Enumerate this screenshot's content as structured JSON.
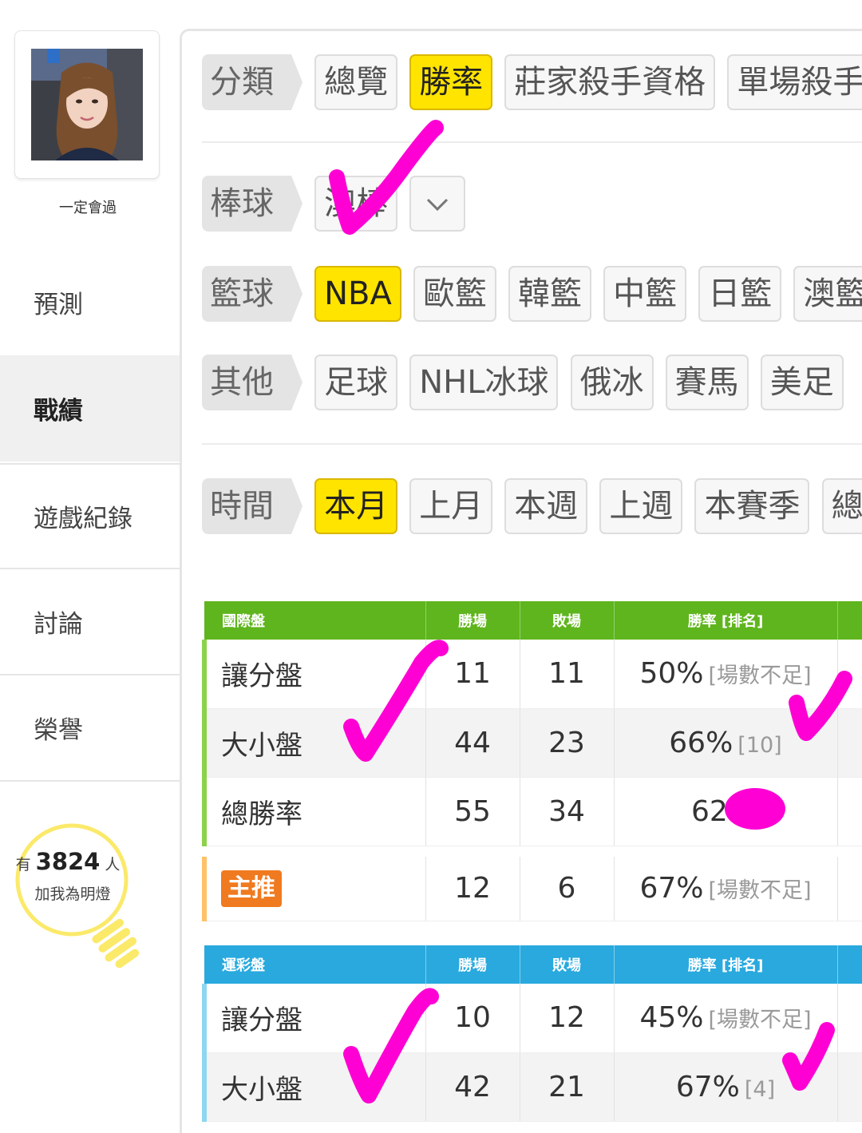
{
  "sidebar": {
    "username": "一定會過",
    "items": [
      {
        "label": "預測"
      },
      {
        "label": "戰績"
      },
      {
        "label": "遊戲紀錄"
      },
      {
        "label": "討論"
      },
      {
        "label": "榮譽"
      }
    ],
    "fans": {
      "prefix": "有",
      "count": "3824",
      "suffix": "人",
      "caption": "加我為明燈"
    }
  },
  "filters": {
    "category": {
      "label": "分類",
      "options": [
        "總覽",
        "勝率",
        "莊家殺手資格",
        "單場殺手"
      ],
      "selected": "勝率"
    },
    "baseball": {
      "label": "棒球",
      "options": [
        "澳棒"
      ],
      "dropdown_icon": "chevron-down-icon"
    },
    "basketball": {
      "label": "籃球",
      "options": [
        "NBA",
        "歐籃",
        "韓籃",
        "中籃",
        "日籃",
        "澳籃"
      ],
      "selected": "NBA"
    },
    "other": {
      "label": "其他",
      "options": [
        "足球",
        "NHL冰球",
        "俄冰",
        "賽馬",
        "美足"
      ]
    },
    "time": {
      "label": "時間",
      "options": [
        "本月",
        "上月",
        "本週",
        "上週",
        "本賽季",
        "總"
      ],
      "selected": "本月"
    }
  },
  "intl_table": {
    "headers": [
      "國際盤",
      "勝場",
      "敗場",
      "勝率 [排名]"
    ],
    "rows": [
      {
        "name": "讓分盤",
        "win": "11",
        "lose": "11",
        "rate": "50%",
        "rank": "[場數不足]"
      },
      {
        "name": "大小盤",
        "win": "44",
        "lose": "23",
        "rate": "66%",
        "rank": "[10]"
      },
      {
        "name": "總勝率",
        "win": "55",
        "lose": "34",
        "rate": "62%",
        "rank": ""
      }
    ],
    "featured": {
      "badge": "主推",
      "win": "12",
      "lose": "6",
      "rate": "67%",
      "rank": "[場數不足]"
    }
  },
  "sport_table": {
    "headers": [
      "運彩盤",
      "勝場",
      "敗場",
      "勝率 [排名]"
    ],
    "rows": [
      {
        "name": "讓分盤",
        "win": "10",
        "lose": "12",
        "rate": "45%",
        "rank": "[場數不足]"
      },
      {
        "name": "大小盤",
        "win": "42",
        "lose": "21",
        "rate": "67%",
        "rank": "[4]"
      }
    ]
  },
  "colors": {
    "selected_chip": "#ffe400",
    "intl_header": "#5fb51d",
    "sport_header": "#29a9de",
    "annotation": "#ff00d4",
    "featured_badge": "#f07a1f"
  }
}
